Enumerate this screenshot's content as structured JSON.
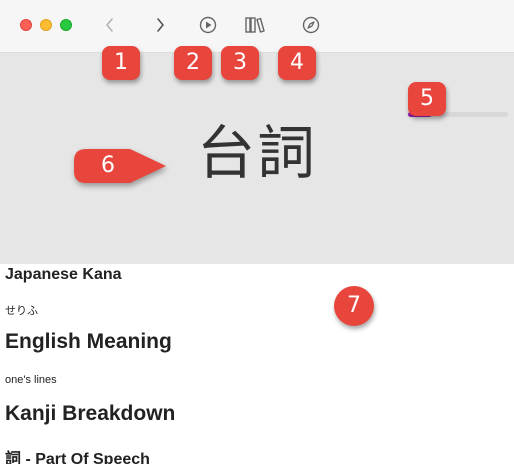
{
  "hero": {
    "word": "台詞",
    "progress_fraction": 0.24
  },
  "sections": {
    "kana_heading": "Japanese Kana",
    "kana_value": "せりふ",
    "meaning_heading": "English Meaning",
    "meaning_value": "one's lines",
    "kanji_heading": "Kanji Breakdown",
    "pos_heading": "詞 - Part Of Speech"
  },
  "annotations": {
    "back": "1",
    "play": "2",
    "library": "3",
    "explore": "4",
    "progress": "5",
    "word": "6",
    "content": "7"
  },
  "colors": {
    "progress_accent": "#9b1fb4",
    "annotation": "#e8453c"
  },
  "icons": {
    "back": "chevron-left-icon",
    "forward": "chevron-right-icon",
    "play": "play-circle-icon",
    "library": "books-icon",
    "explore": "compass-icon"
  }
}
